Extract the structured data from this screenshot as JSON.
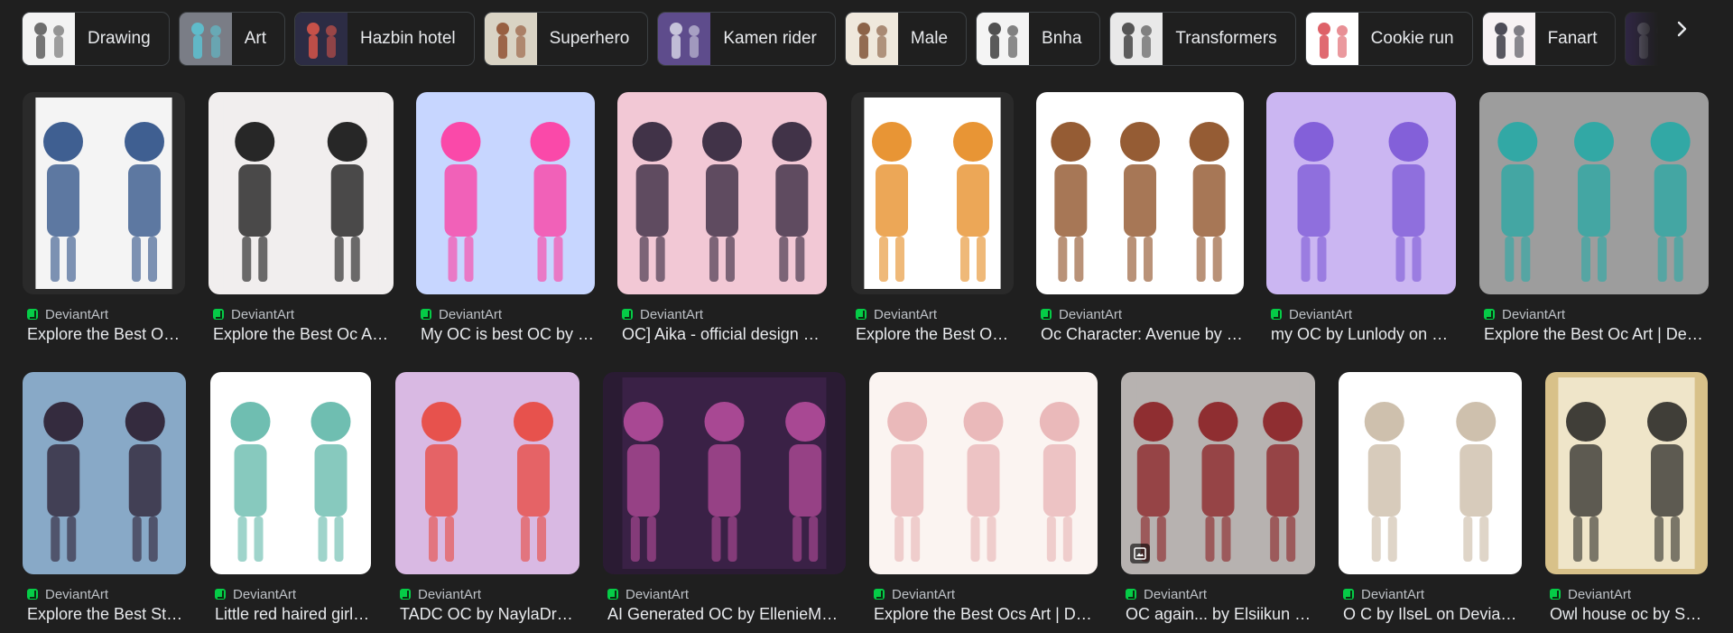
{
  "chips": [
    {
      "label": "Drawing",
      "icon": "sketch-thumbnail",
      "bg": "#f3f3f3",
      "fg": "#555555"
    },
    {
      "label": "Art",
      "icon": "art-thumbnail",
      "bg": "#7a7d86",
      "fg": "#5bc6d6"
    },
    {
      "label": "Hazbin hotel",
      "icon": "hazbin-thumbnail",
      "bg": "#2c2c44",
      "fg": "#e2584a"
    },
    {
      "label": "Superhero",
      "icon": "superhero-thumbnail",
      "bg": "#d9d3c4",
      "fg": "#8c4a2a"
    },
    {
      "label": "Kamen rider",
      "icon": "kamen-rider-thumbnail",
      "bg": "#5e4c8c",
      "fg": "#d8d8e8"
    },
    {
      "label": "Male",
      "icon": "male-thumbnail",
      "bg": "#efe8dc",
      "fg": "#7a4b2e"
    },
    {
      "label": "Bnha",
      "icon": "bnha-thumbnail",
      "bg": "#f4f4f4",
      "fg": "#333333"
    },
    {
      "label": "Transformers",
      "icon": "transformers-thumbnail",
      "bg": "#e9e9e9",
      "fg": "#3a3a3a"
    },
    {
      "label": "Cookie run",
      "icon": "cookie-run-thumbnail",
      "bg": "#ffffff",
      "fg": "#d8454e"
    },
    {
      "label": "Fanart",
      "icon": "fanart-thumbnail",
      "bg": "#f7f2f4",
      "fg": "#2f2f3b"
    },
    {
      "label": "",
      "icon": "partial-thumbnail",
      "bg": "#3e2c63",
      "fg": "#c9c3e2"
    }
  ],
  "row1": [
    {
      "source": "DeviantArt",
      "title": "Explore the Best OC Art | DeviantArt",
      "bg": "#2a2a2a",
      "inner": "#f4f4f4",
      "accent": "#2b4f86"
    },
    {
      "source": "DeviantArt",
      "title": "Explore the Best Oc Art | DeviantArt",
      "bg": "#f1eeee",
      "inner": "#f1eeee",
      "accent": "#111111"
    },
    {
      "source": "DeviantArt",
      "title": "My OC is best OC by on DeviantArt",
      "bg": "#c7d6ff",
      "inner": "#c7d6ff",
      "accent": "#ff3aa0"
    },
    {
      "source": "DeviantArt",
      "title": "OC] Aika - official design by DeviantArt",
      "bg": "#f2c8d5",
      "inner": "#f2c8d5",
      "accent": "#2d2238"
    },
    {
      "source": "DeviantArt",
      "title": "Explore the Best OC Art | DeviantArt",
      "bg": "#2a2a2a",
      "inner": "#ffffff",
      "accent": "#e58a1f"
    },
    {
      "source": "DeviantArt",
      "title": "Oc Character: Avenue by on DeviantArt",
      "bg": "#ffffff",
      "inner": "#ffffff",
      "accent": "#8a4a1e"
    },
    {
      "source": "DeviantArt",
      "title": "my OC by Lunlody on DeviantArt",
      "bg": "#cbb6f2",
      "inner": "#cbb6f2",
      "accent": "#7b57d6"
    },
    {
      "source": "DeviantArt",
      "title": "Explore the Best Oc Art | DeviantArt",
      "bg": "#9d9d9d",
      "inner": "#9d9d9d",
      "accent": "#27aaa6"
    }
  ],
  "row2": [
    {
      "source": "DeviantArt",
      "title": "Explore the Best Stuff | DeviantArt",
      "bg": "#88a9c7",
      "inner": "#88a9c7",
      "accent": "#2b1d2f",
      "badge": false
    },
    {
      "source": "DeviantArt",
      "title": "Little red haired girl by DeviantArt",
      "bg": "#ffffff",
      "inner": "#ffffff",
      "accent": "#5fb7a8",
      "badge": false
    },
    {
      "source": "DeviantArt",
      "title": "TADC OC by NaylaDraws",
      "bg": "#d9b9e3",
      "inner": "#d9b9e3",
      "accent": "#e8473c",
      "badge": false
    },
    {
      "source": "DeviantArt",
      "title": "AI Generated OC by EllenieMade",
      "bg": "#2a1b33",
      "inner": "#3a2146",
      "accent": "#b54c9b",
      "badge": false
    },
    {
      "source": "DeviantArt",
      "title": "Explore the Best Ocs Art | DeviantArt",
      "bg": "#fbf4f1",
      "inner": "#fbf4f1",
      "accent": "#e8b3b4",
      "badge": false
    },
    {
      "source": "DeviantArt",
      "title": "OC again... by Elsiikun on DeviantArt",
      "bg": "#b7b2b0",
      "inner": "#b7b2b0",
      "accent": "#8b1f23",
      "badge": true
    },
    {
      "source": "DeviantArt",
      "title": "O C by IlseL on DeviantArt",
      "bg": "#ffffff",
      "inner": "#ffffff",
      "accent": "#c9b9a4",
      "badge": false
    },
    {
      "source": "DeviantArt",
      "title": "Owl house oc by Sylvie",
      "bg": "#d8c189",
      "inner": "#efe5c9",
      "accent": "#2c2b28",
      "badge": false
    }
  ]
}
